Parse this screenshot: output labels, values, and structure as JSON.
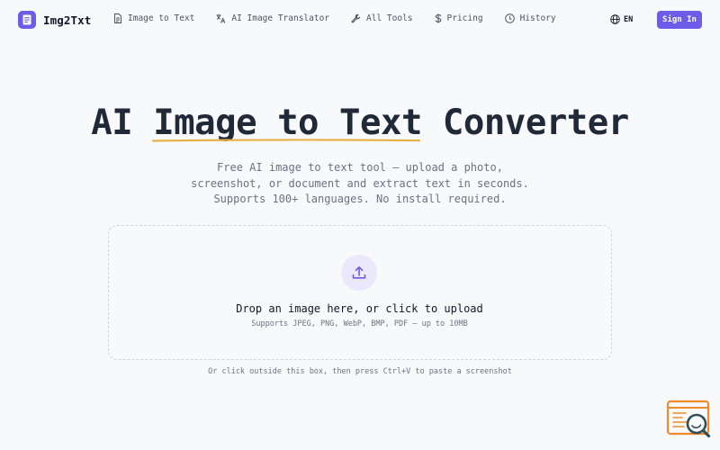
{
  "brand": {
    "name": "Img2Txt"
  },
  "nav": {
    "items": [
      {
        "label": "Image to Text",
        "icon": "document-icon"
      },
      {
        "label": "AI Image Translator",
        "icon": "translate-icon"
      },
      {
        "label": "All Tools",
        "icon": "wrench-icon"
      },
      {
        "label": "Pricing",
        "icon": "dollar-icon"
      },
      {
        "label": "History",
        "icon": "clock-icon"
      }
    ]
  },
  "header": {
    "language": "EN",
    "sign_in": "Sign In"
  },
  "hero": {
    "title_prefix": "AI",
    "title_highlight": "Image to Text",
    "title_suffix": "Converter",
    "subtitle_lines": [
      "Free AI image to text tool — upload a photo,",
      "screenshot, or document and extract text in seconds.",
      "Supports 100+ languages. No install required."
    ]
  },
  "upload": {
    "title": "Drop an image here, or click to upload",
    "formats": "Supports JPEG, PNG, WebP, BMP, PDF — up to 10MB",
    "paste_hint": "Or click outside this box, then press Ctrl+V to paste a screenshot"
  },
  "colors": {
    "accent": "#6d5ce7",
    "highlight_underline": "#e8b04a",
    "upload_circle_bg": "#ebe8fb",
    "widget_orange": "#ef8a2f",
    "widget_teal": "#2f4f57"
  }
}
